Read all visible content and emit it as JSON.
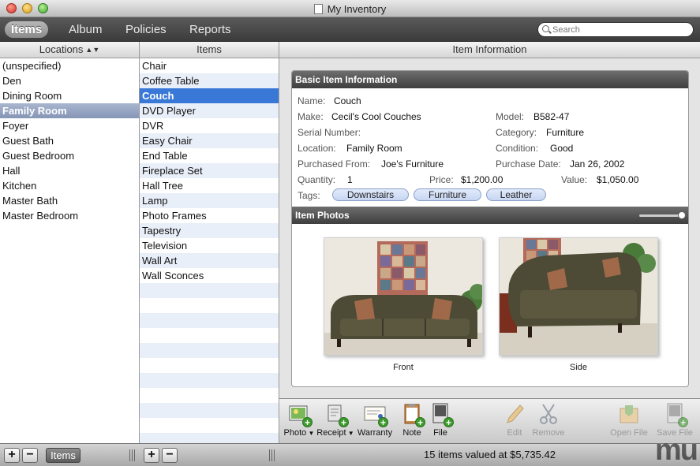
{
  "window": {
    "title": "My Inventory"
  },
  "tabs": [
    {
      "label": "Items",
      "active": true
    },
    {
      "label": "Album",
      "active": false
    },
    {
      "label": "Policies",
      "active": false
    },
    {
      "label": "Reports",
      "active": false
    }
  ],
  "search": {
    "placeholder": "Search"
  },
  "columns": {
    "locations": "Locations",
    "items": "Items",
    "info": "Item Information"
  },
  "locations": [
    "(unspecified)",
    "Den",
    "Dining Room",
    "Family Room",
    "Foyer",
    "Guest Bath",
    "Guest Bedroom",
    "Hall",
    "Kitchen",
    "Master Bath",
    "Master Bedroom"
  ],
  "selected_location": "Family Room",
  "items": [
    "Chair",
    "Coffee Table",
    "Couch",
    "DVD Player",
    "DVR",
    "Easy Chair",
    "End Table",
    "Fireplace Set",
    "Hall Tree",
    "Lamp",
    "Photo Frames",
    "Tapestry",
    "Television",
    "Wall Art",
    "Wall Sconces"
  ],
  "selected_item": "Couch",
  "basic": {
    "header": "Basic Item Information",
    "name_label": "Name:",
    "name": "Couch",
    "make_label": "Make:",
    "make": "Cecil's Cool Couches",
    "model_label": "Model:",
    "model": "B582-47",
    "serial_label": "Serial Number:",
    "serial": "",
    "category_label": "Category:",
    "category": "Furniture",
    "location_label": "Location:",
    "location": "Family Room",
    "condition_label": "Condition:",
    "condition": "Good",
    "purchased_from_label": "Purchased From:",
    "purchased_from": "Joe's Furniture",
    "purchase_date_label": "Purchase Date:",
    "purchase_date": "Jan 26, 2002",
    "quantity_label": "Quantity:",
    "quantity": "1",
    "price_label": "Price:",
    "price": "$1,200.00",
    "value_label": "Value:",
    "value": "$1,050.00",
    "tags_label": "Tags:",
    "tags": [
      "Downstairs",
      "Furniture",
      "Leather"
    ]
  },
  "photos": {
    "header": "Item Photos",
    "zoom": 1.0,
    "captions": [
      "Front",
      "Side"
    ]
  },
  "actions": [
    {
      "label": "Photo",
      "icon": "photo-add-icon",
      "enabled": true
    },
    {
      "label": "Receipt",
      "icon": "receipt-add-icon",
      "enabled": true
    },
    {
      "label": "Warranty",
      "icon": "warranty-add-icon",
      "enabled": true
    },
    {
      "label": "Note",
      "icon": "note-add-icon",
      "enabled": true
    },
    {
      "label": "File",
      "icon": "file-add-icon",
      "enabled": true
    },
    {
      "label": "Edit",
      "icon": "pencil-icon",
      "enabled": false
    },
    {
      "label": "Remove",
      "icon": "scissors-icon",
      "enabled": false
    },
    {
      "label": "Open File",
      "icon": "open-file-icon",
      "enabled": false
    },
    {
      "label": "Save File",
      "icon": "save-file-icon",
      "enabled": false
    }
  ],
  "footer": {
    "items_button": "Items",
    "status": "15 items valued at $5,735.42",
    "watermark": "mu"
  },
  "colors": {
    "selection": "#3a78d8",
    "location_selection": "#8e9dbb",
    "tag_fill": "#d3def5",
    "header_dark": "#4a4a4a"
  }
}
